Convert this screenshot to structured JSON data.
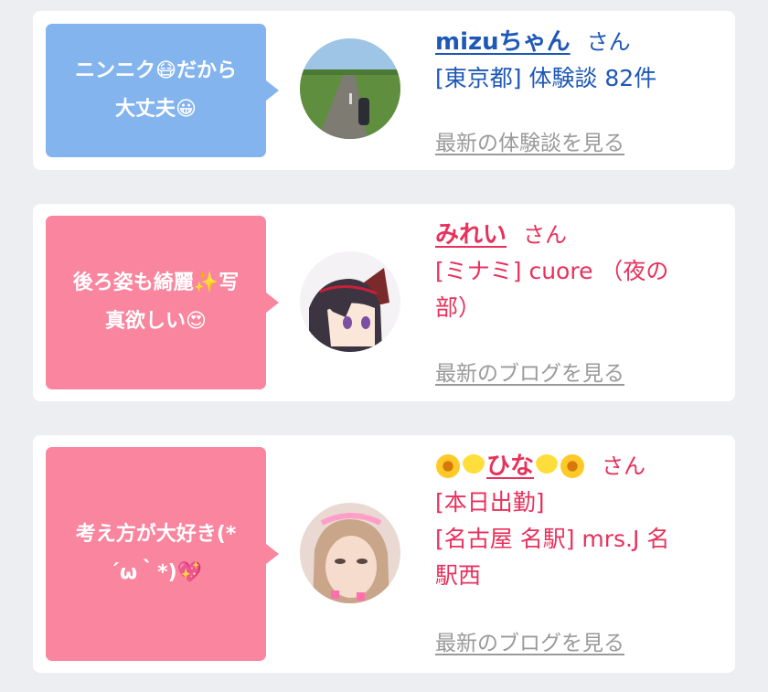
{
  "colors": {
    "blue_bubble": "#84b4ee",
    "pink_bubble": "#f9859f",
    "blue_text": "#1e58b7",
    "pink_text": "#e8315c"
  },
  "cards": [
    {
      "bubble_line1": "ニンニク😷だから",
      "bubble_line2": "大丈夫😀",
      "name": "mizuちゃん",
      "honorific": "さん",
      "meta1": "[東京都] 体験談 82件",
      "link": "最新の体験談を見る"
    },
    {
      "bubble_line1": "後ろ姿も綺麗✨写",
      "bubble_line2": "真欲しい😍",
      "name": "みれい",
      "honorific": "さん",
      "meta1": "[ミナミ] cuore （夜の",
      "meta2": "部）",
      "link": "最新のブログを見る"
    },
    {
      "bubble_line1": "考え方が大好き(*",
      "bubble_line2": "´ω｀*)💖",
      "name": "ひな",
      "name_decor_icons": [
        "sunflower-icon",
        "chick-icon",
        "chick-icon",
        "sunflower-icon"
      ],
      "honorific": "さん",
      "meta1": "[本日出勤]",
      "meta2": "[名古屋 名駅] mrs.J 名",
      "meta3": "駅西",
      "link": "最新のブログを見る"
    }
  ]
}
